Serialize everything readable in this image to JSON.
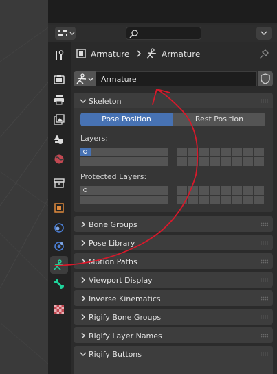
{
  "header": {
    "editor_type_icon": "properties-editor-icon",
    "search_placeholder": "",
    "search_icon": "search-icon"
  },
  "breadcrumb": {
    "object_name": "Armature",
    "data_name": "Armature"
  },
  "datablock": {
    "name": "Armature"
  },
  "tabs": [
    {
      "name": "tool-tab",
      "icon": "wrench-screwdriver-icon"
    },
    {
      "name": "render-tab",
      "icon": "camera-back-icon"
    },
    {
      "name": "output-tab",
      "icon": "printer-icon"
    },
    {
      "name": "view-layer-tab",
      "icon": "image-stack-icon"
    },
    {
      "name": "scene-tab",
      "icon": "cone-sphere-icon"
    },
    {
      "name": "world-tab",
      "icon": "globe-icon"
    },
    {
      "name": "collection-tab",
      "icon": "box-icon"
    },
    {
      "name": "object-tab",
      "icon": "orange-square-icon"
    },
    {
      "name": "modifiers-tab",
      "icon": "blue-circle-icon"
    },
    {
      "name": "physics-tab",
      "icon": "orbit-icon"
    },
    {
      "name": "object-data-tab",
      "icon": "armature-icon",
      "active": true
    },
    {
      "name": "bone-tab",
      "icon": "bone-icon"
    },
    {
      "name": "texture-tab",
      "icon": "checker-icon"
    }
  ],
  "skeleton": {
    "title": "Skeleton",
    "pose_position": "Pose Position",
    "rest_position": "Rest Position",
    "layers_label": "Layers:",
    "protected_label": "Protected Layers:"
  },
  "panels": [
    {
      "title": "Bone Groups"
    },
    {
      "title": "Pose Library"
    },
    {
      "title": "Motion Paths"
    },
    {
      "title": "Viewport Display"
    },
    {
      "title": "Inverse Kinematics"
    },
    {
      "title": "Rigify Bone Groups"
    },
    {
      "title": "Rigify Layer Names"
    },
    {
      "title": "Rigify Buttons"
    }
  ],
  "colors": {
    "accent": "#4772b3",
    "annotation": "#d8192b",
    "panel_bg": "#3d3d3d",
    "editor_bg": "#2b2b2b"
  }
}
